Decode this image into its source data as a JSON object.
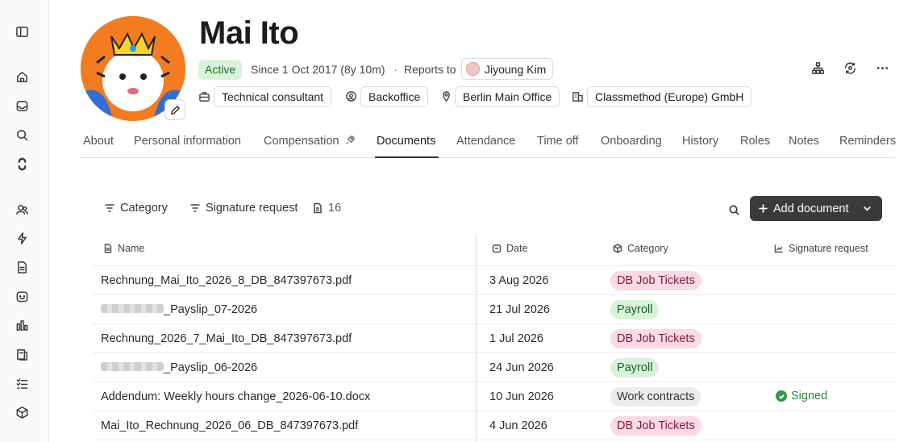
{
  "profile": {
    "name": "Mai Ito",
    "status": "Active",
    "since": "Since 1 Oct 2017 (8y 10m)",
    "separator": "·",
    "reports_to_label": "Reports to",
    "manager": "Jiyoung Kim",
    "role": "Technical consultant",
    "team": "Backoffice",
    "office": "Berlin Main Office",
    "company": "Classmethod (Europe) GmbH"
  },
  "tabs": [
    "About",
    "Personal information",
    "Compensation",
    "Documents",
    "Attendance",
    "Time off",
    "Onboarding",
    "History",
    "Roles",
    "Notes",
    "Reminders"
  ],
  "active_tab": "Documents",
  "toolbar": {
    "filter_category": "Category",
    "filter_signature": "Signature request",
    "doc_count": "16",
    "add_document": "Add document"
  },
  "table": {
    "headers": {
      "name": "Name",
      "date": "Date",
      "category": "Category",
      "signature": "Signature request"
    },
    "rows": [
      {
        "name": "Rechnung_Mai_Ito_2026_8_DB_847397673.pdf",
        "redacted_prefix": false,
        "date": "3 Aug 2026",
        "category": "DB Job Tickets",
        "cat_style": "pink",
        "signature": ""
      },
      {
        "name": "_Payslip_07-2026",
        "redacted_prefix": true,
        "date": "21 Jul 2026",
        "category": "Payroll",
        "cat_style": "green",
        "signature": ""
      },
      {
        "name": "Rechnung_2026_7_Mai_Ito_DB_847397673.pdf",
        "redacted_prefix": false,
        "date": "1 Jul 2026",
        "category": "DB Job Tickets",
        "cat_style": "pink",
        "signature": ""
      },
      {
        "name": "_Payslip_06-2026",
        "redacted_prefix": true,
        "date": "24 Jun 2026",
        "category": "Payroll",
        "cat_style": "green",
        "signature": ""
      },
      {
        "name": "Addendum: Weekly hours change_2026-06-10.docx",
        "redacted_prefix": false,
        "date": "10 Jun 2026",
        "category": "Work contracts",
        "cat_style": "grey",
        "signature": "Signed"
      },
      {
        "name": "Mai_Ito_Rechnung_2026_06_DB_847397673.pdf",
        "redacted_prefix": false,
        "date": "4 Jun 2026",
        "category": "DB Job Tickets",
        "cat_style": "pink",
        "signature": ""
      }
    ]
  },
  "colors": {
    "active_badge": "#daf2dc",
    "tag_pink": "#fbd9e5",
    "tag_green": "#d7f3d9",
    "tag_grey": "#ececec",
    "primary_button": "#3a3a3a",
    "signed": "#2e8b3e"
  },
  "icons": {
    "sidebar": [
      "sidebar-toggle-icon",
      "home-icon",
      "inbox-icon",
      "search-icon",
      "integrations-icon",
      "people-icon",
      "automation-icon",
      "document-icon",
      "calendar-icon",
      "analytics-icon",
      "templates-icon",
      "tasks-icon",
      "package-icon"
    ],
    "header_actions": [
      "org-chart-icon",
      "sync-icon",
      "more-icon"
    ]
  }
}
